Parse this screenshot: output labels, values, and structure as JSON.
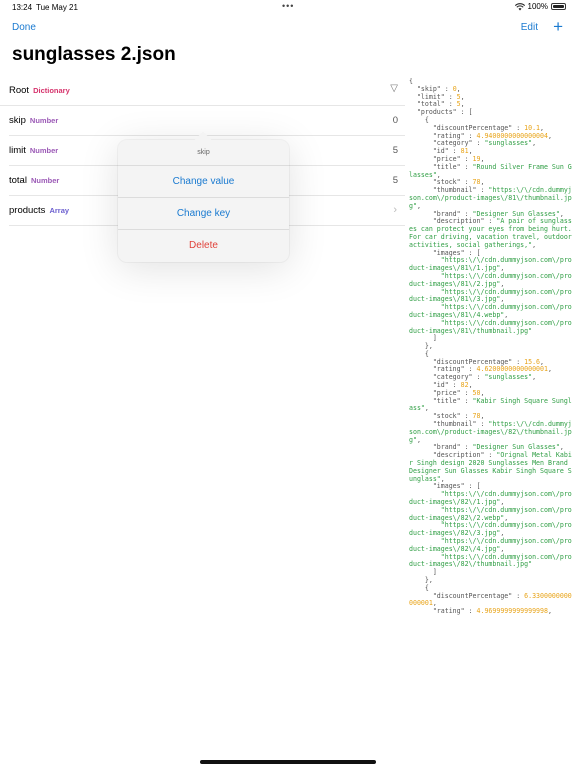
{
  "status": {
    "time": "13:24",
    "date": "Tue May 21",
    "battery": "100%"
  },
  "nav": {
    "done": "Done",
    "edit": "Edit",
    "add": "+",
    "title": "sunglasses 2.json"
  },
  "tree": {
    "root": {
      "key": "Root",
      "type": "Dictionary"
    },
    "rows": [
      {
        "key": "skip",
        "type": "Number",
        "value": "0"
      },
      {
        "key": "limit",
        "type": "Number",
        "value": "5"
      },
      {
        "key": "total",
        "type": "Number",
        "value": "5"
      },
      {
        "key": "products",
        "type": "Array",
        "value": ""
      }
    ]
  },
  "menu": {
    "header": "skip",
    "change_value": "Change value",
    "change_key": "Change key",
    "delete": "Delete"
  },
  "json_text": [
    [
      "{\n  \"skip\" : ",
      "p"
    ],
    [
      "0",
      "n"
    ],
    [
      ",\n  \"limit\" : ",
      "p"
    ],
    [
      "5",
      "n"
    ],
    [
      ",\n  \"total\" : ",
      "p"
    ],
    [
      "5",
      "n"
    ],
    [
      ",\n  \"products\" : [\n    {\n      \"discountPercentage\" : ",
      "p"
    ],
    [
      "10.1",
      "n"
    ],
    [
      ",\n      \"rating\" : ",
      "p"
    ],
    [
      "4.9400000000000004",
      "n"
    ],
    [
      ",\n      \"category\" : ",
      "p"
    ],
    [
      "\"sunglasses\"",
      "s"
    ],
    [
      ",\n      \"id\" : ",
      "p"
    ],
    [
      "81",
      "n"
    ],
    [
      ",\n      \"price\" : ",
      "p"
    ],
    [
      "19",
      "n"
    ],
    [
      ",\n      \"title\" : ",
      "p"
    ],
    [
      "\"Round Silver Frame Sun Glasses\"",
      "s"
    ],
    [
      ",\n      \"stock\" : ",
      "p"
    ],
    [
      "78",
      "n"
    ],
    [
      ",\n      \"thumbnail\" : ",
      "p"
    ],
    [
      "\"https:\\/\\/cdn.dummyjson.com\\/product-images\\/81\\/thumbnail.jpg\"",
      "s"
    ],
    [
      ",\n      \"brand\" : ",
      "p"
    ],
    [
      "\"Designer Sun Glasses\"",
      "s"
    ],
    [
      ",\n      \"description\" : ",
      "p"
    ],
    [
      "\"A pair of sunglasses can protect your eyes from being hurt. For car driving, vacation travel, outdoor activities, social gatherings,\"",
      "s"
    ],
    [
      ",\n      \"images\" : [\n        ",
      "p"
    ],
    [
      "\"https:\\/\\/cdn.dummyjson.com\\/product-images\\/81\\/1.jpg\"",
      "s"
    ],
    [
      ",\n        ",
      "p"
    ],
    [
      "\"https:\\/\\/cdn.dummyjson.com\\/product-images\\/81\\/2.jpg\"",
      "s"
    ],
    [
      ",\n        ",
      "p"
    ],
    [
      "\"https:\\/\\/cdn.dummyjson.com\\/product-images\\/81\\/3.jpg\"",
      "s"
    ],
    [
      ",\n        ",
      "p"
    ],
    [
      "\"https:\\/\\/cdn.dummyjson.com\\/product-images\\/81\\/4.webp\"",
      "s"
    ],
    [
      ",\n        ",
      "p"
    ],
    [
      "\"https:\\/\\/cdn.dummyjson.com\\/product-images\\/81\\/thumbnail.jpg\"",
      "s"
    ],
    [
      "\n      ]\n    },\n    {\n      \"discountPercentage\" : ",
      "p"
    ],
    [
      "15.6",
      "n"
    ],
    [
      ",\n      \"rating\" : ",
      "p"
    ],
    [
      "4.6200000000000001",
      "n"
    ],
    [
      ",\n      \"category\" : ",
      "p"
    ],
    [
      "\"sunglasses\"",
      "s"
    ],
    [
      ",\n      \"id\" : ",
      "p"
    ],
    [
      "82",
      "n"
    ],
    [
      ",\n      \"price\" : ",
      "p"
    ],
    [
      "50",
      "n"
    ],
    [
      ",\n      \"title\" : ",
      "p"
    ],
    [
      "\"Kabir Singh Square Sunglass\"",
      "s"
    ],
    [
      ",\n      \"stock\" : ",
      "p"
    ],
    [
      "78",
      "n"
    ],
    [
      ",\n      \"thumbnail\" : ",
      "p"
    ],
    [
      "\"https:\\/\\/cdn.dummyjson.com\\/product-images\\/82\\/thumbnail.jpg\"",
      "s"
    ],
    [
      ",\n      \"brand\" : ",
      "p"
    ],
    [
      "\"Designer Sun Glasses\"",
      "s"
    ],
    [
      ",\n      \"description\" : ",
      "p"
    ],
    [
      "\"Orignal Metal Kabir Singh design 2020 Sunglasses Men Brand Designer Sun Glasses Kabir Singh Square Sunglass\"",
      "s"
    ],
    [
      ",\n      \"images\" : [\n        ",
      "p"
    ],
    [
      "\"https:\\/\\/cdn.dummyjson.com\\/product-images\\/82\\/1.jpg\"",
      "s"
    ],
    [
      ",\n        ",
      "p"
    ],
    [
      "\"https:\\/\\/cdn.dummyjson.com\\/product-images\\/82\\/2.webp\"",
      "s"
    ],
    [
      ",\n        ",
      "p"
    ],
    [
      "\"https:\\/\\/cdn.dummyjson.com\\/product-images\\/82\\/3.jpg\"",
      "s"
    ],
    [
      ",\n        ",
      "p"
    ],
    [
      "\"https:\\/\\/cdn.dummyjson.com\\/product-images\\/82\\/4.jpg\"",
      "s"
    ],
    [
      ",\n        ",
      "p"
    ],
    [
      "\"https:\\/\\/cdn.dummyjson.com\\/product-images\\/82\\/thumbnail.jpg\"",
      "s"
    ],
    [
      "\n      ]\n    },\n    {\n      \"discountPercentage\" : ",
      "p"
    ],
    [
      "6.3300000000000001",
      "n"
    ],
    [
      ",\n      \"rating\" : ",
      "p"
    ],
    [
      "4.9699999999999998",
      "n"
    ],
    [
      ",",
      "p"
    ]
  ],
  "colors": {
    "accent": "#1a7ad0",
    "delete": "#e0423a",
    "json_string": "#2f9e44",
    "json_number": "#e8a317",
    "type_dictionary": "#d6336c",
    "type_number": "#9b59b6",
    "type_array": "#6b5ecf"
  },
  "icons": {
    "wifi": "wifi-icon",
    "battery": "battery-icon",
    "filter": "filter-icon",
    "chevron": "chevron-right-icon",
    "add": "plus-icon"
  }
}
